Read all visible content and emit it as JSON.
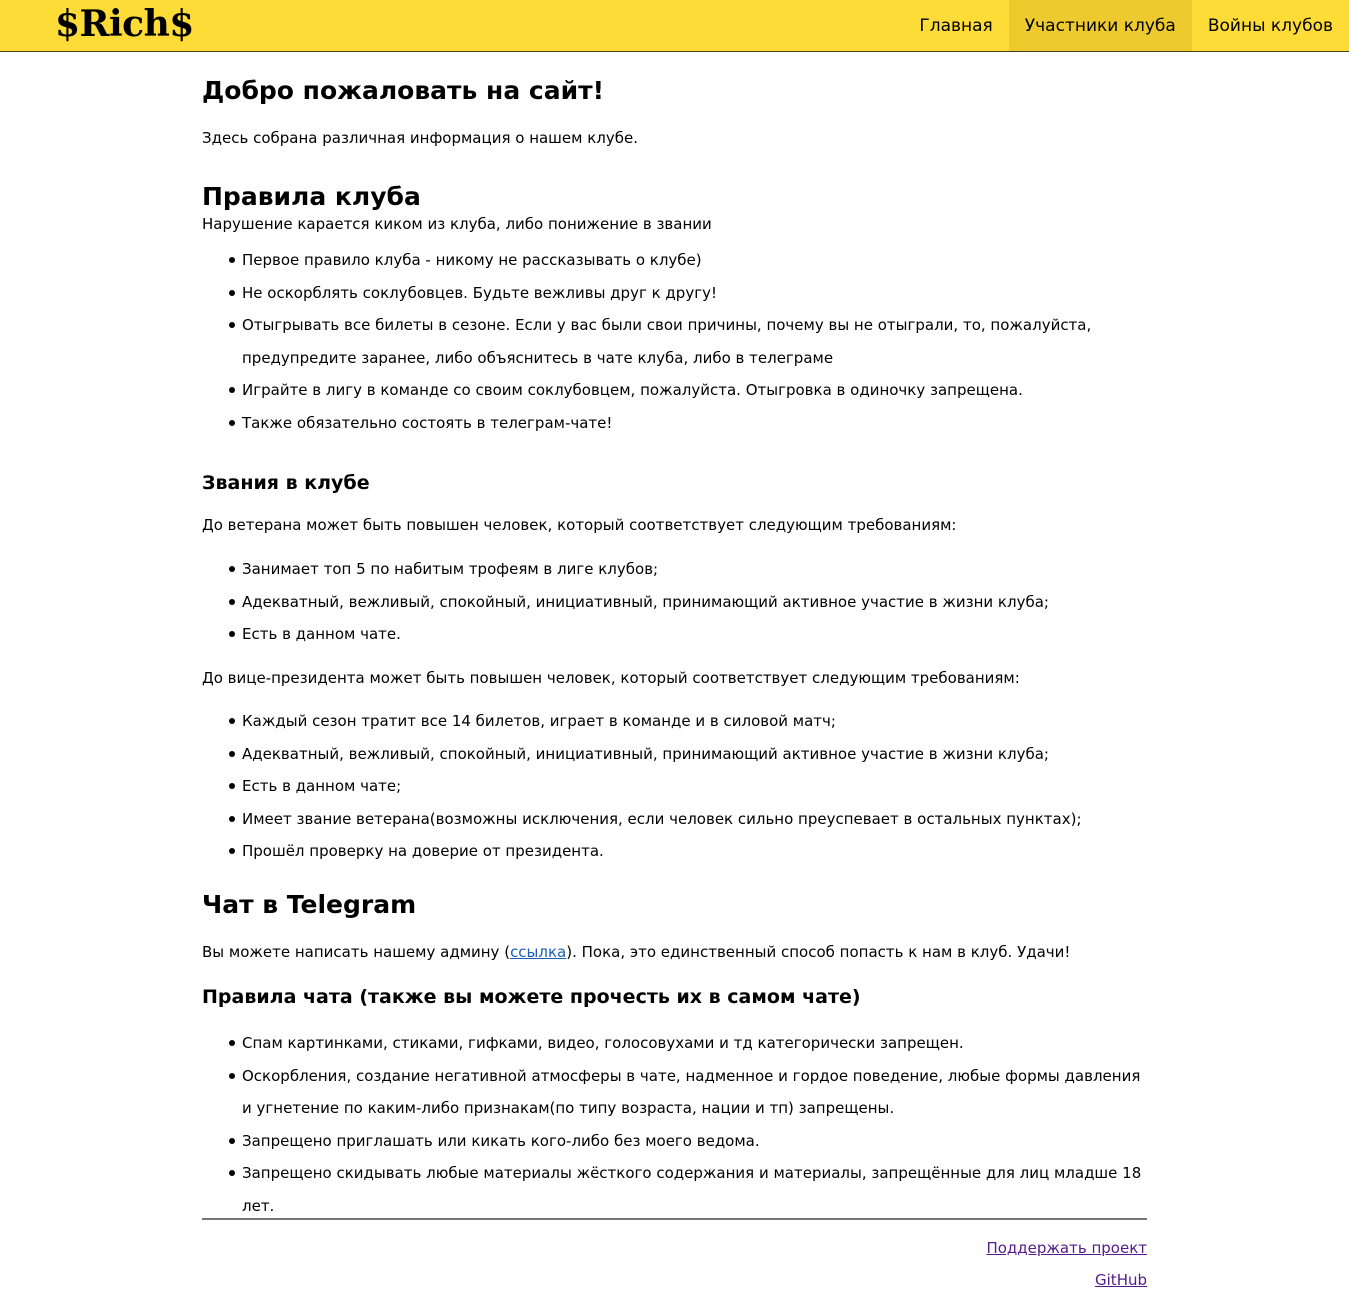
{
  "navbar": {
    "brand": "$Rich$",
    "links": [
      {
        "label": "Главная"
      },
      {
        "label": "Участники клуба"
      },
      {
        "label": "Войны клубов"
      }
    ]
  },
  "welcome": {
    "title": "Добро пожаловать на сайт!",
    "text": "Здесь собрана различная информация о нашем клубе."
  },
  "rules": {
    "title": "Правила клуба",
    "intro": "Нарушение карается киком из клуба, либо понижение в звании",
    "items": [
      "Первое правило клуба - никому не рассказывать о клубе)",
      "Не оскорблять соклубовцев. Будьте вежливы друг к другу!",
      "Отыгрывать все билеты в сезоне. Если у вас были свои причины, почему вы не отыграли, то, пожалуйста, предупредите заранее, либо объяснитесь в чате клуба, либо в телеграме",
      "Играйте в лигу в команде со своим соклубовцем, пожалуйста. Отыгровка в одиночку запрещена.",
      "Также обязательно состоять в телеграм-чате!"
    ]
  },
  "ranks": {
    "title": "Звания в клубе",
    "veteran_intro": "До ветерана может быть повышен человек, который соответствует следующим требованиям:",
    "veteran_items": [
      "Занимает топ 5 по набитым трофеям в лиге клубов;",
      "Адекватный, вежливый, спокойный, инициативный, принимающий активное участие в жизни клуба;",
      "Есть в данном чате."
    ],
    "vp_intro": "До вице-президента может быть повышен человек, который соответствует следующим требованиям:",
    "vp_items": [
      "Каждый сезон тратит все 14 билетов, играет в команде и в силовой матч;",
      "Адекватный, вежливый, спокойный, инициативный, принимающий активное участие в жизни клуба;",
      "Есть в данном чате;",
      "Имеет звание ветерана(возможны исключения, если человек сильно преуспевает в остальных пунктах);",
      "Прошёл проверку на доверие от президента."
    ]
  },
  "telegram": {
    "title": "Чат в Telegram",
    "text_before": "Вы можете написать нашему админу (",
    "link_label": "ссылка",
    "text_after": "). Пока, это единственный способ попасть к нам в клуб. Удачи!"
  },
  "chat_rules": {
    "title": "Правила чата (также вы можете прочесть их в самом чате)",
    "items": [
      "Спам картинками, стиками, гифками, видео, голосовухами и тд категорически запрещен.",
      "Оскорбления, создание негативной атмосферы в чате, надменное и гордое поведение, любые формы давления и угнетение по каким-либо признакам(по типу возраста, нации и тп) запрещены.",
      "Запрещено приглашать или кикать кого-либо без моего ведома.",
      "Запрещено скидывать любые материалы жёсткого содержания и материалы, запрещённые для лиц младше 18 лет."
    ]
  },
  "footer": {
    "support_label": "Поддержать проект",
    "github_label": "GitHub"
  },
  "colors": {
    "navbar_bg": "#fddc37",
    "nav_active_bg": "#edcb2e",
    "link": "#1a5fb4",
    "visited_link": "#551a8b"
  }
}
